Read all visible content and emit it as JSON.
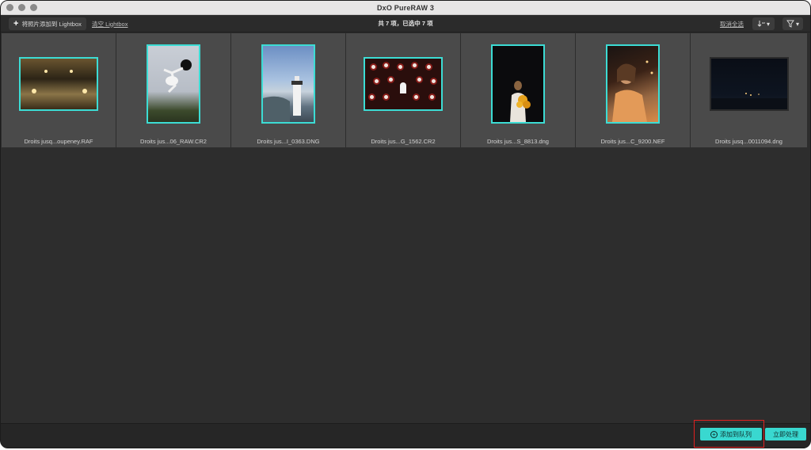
{
  "window": {
    "title": "DxO PureRAW 3"
  },
  "toolbar": {
    "add_label": "将照片添加到 Lightbox",
    "clear_label": "清空 Lightbox",
    "count_text": "共 7 项，已选中 7 项",
    "deselect_label": "取消全选",
    "sort_icon": "sort-icon",
    "filter_icon": "filter-icon"
  },
  "photos": [
    {
      "filename": "Droits jusq...oupeney.RAF",
      "orientation": "landscape",
      "selected": true
    },
    {
      "filename": "Droits jus...06_RAW.CR2",
      "orientation": "portrait",
      "selected": true
    },
    {
      "filename": "Droits jus...I_0363.DNG",
      "orientation": "portrait",
      "selected": true
    },
    {
      "filename": "Droits jus...G_1562.CR2",
      "orientation": "landscape",
      "selected": true
    },
    {
      "filename": "Droits jus...S_8813.dng",
      "orientation": "portrait",
      "selected": true
    },
    {
      "filename": "Droits jus...C_9200.NEF",
      "orientation": "portrait",
      "selected": true
    },
    {
      "filename": "Droits jusq...0011094.dng",
      "orientation": "landscape",
      "selected": true
    }
  ],
  "footer": {
    "add_to_queue_label": "添加到队列",
    "process_now_label": "立即处理"
  },
  "colors": {
    "accent": "#39d8d0",
    "highlight": "#e02020"
  }
}
